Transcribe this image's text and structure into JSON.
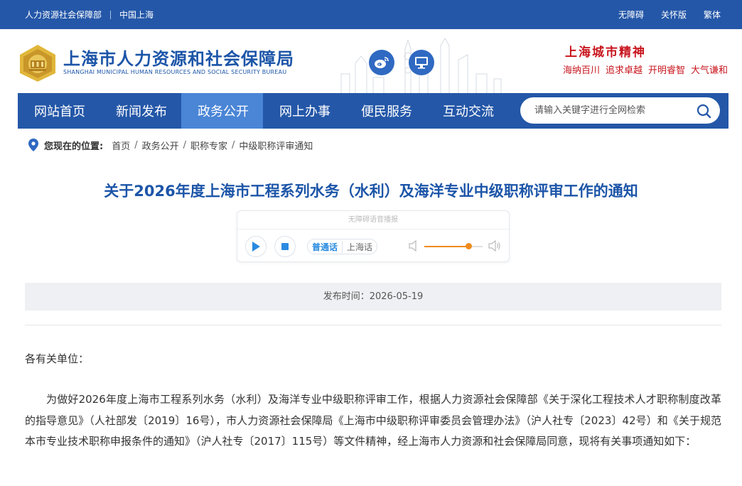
{
  "topbar": {
    "org": "人力资源社会保障部",
    "region": "中国上海",
    "links": [
      "无障碍",
      "关怀版",
      "繁体"
    ]
  },
  "header": {
    "title": "上海市人力资源和社会保障局",
    "subtitle": "SHANGHAI MUNICIPAL HUMAN RESOURCES AND SOCIAL SECURITY BUREAU",
    "spirit_title": "上海城市精神",
    "spirit_words": [
      "海纳百川",
      "追求卓越",
      "开明睿智",
      "大气谦和"
    ],
    "brand_color": "#2457a8",
    "spirit_color": "#c8161e"
  },
  "nav": {
    "items": [
      "网站首页",
      "新闻发布",
      "政务公开",
      "网上办事",
      "便民服务",
      "互动交流"
    ],
    "active": "政务公开",
    "search_placeholder": "请输入关键字进行全网检索"
  },
  "breadcrumb": {
    "label": "您现在的位置:",
    "items": [
      "首页",
      "政务公开",
      "职称专家",
      "中级职称评审通知"
    ]
  },
  "article": {
    "title": "关于2026年度上海市工程系列水务（水利）及海洋专业中级职称评审工作的通知",
    "player": {
      "caption": "无障碍语音播报",
      "lang_mandarin": "普通话",
      "lang_shanghai": "上海话",
      "volume": 0.75
    },
    "publish_time": "发布时间：2026-05-19",
    "greeting": "各有关单位：",
    "paragraph": "为做好2026年度上海市工程系列水务（水利）及海洋专业中级职称评审工作，根据人力资源社会保障部《关于深化工程技术人才职称制度改革的指导意见》（人社部发〔2019〕16号），市人力资源社会保障局《上海市中级职称评审委员会管理办法》（沪人社专〔2023〕42号）和《关于规范本市专业技术职称申报条件的通知》（沪人社专〔2017〕115号）等文件精神，经上海市人力资源和社会保障局同意，现将有关事项通知如下："
  }
}
